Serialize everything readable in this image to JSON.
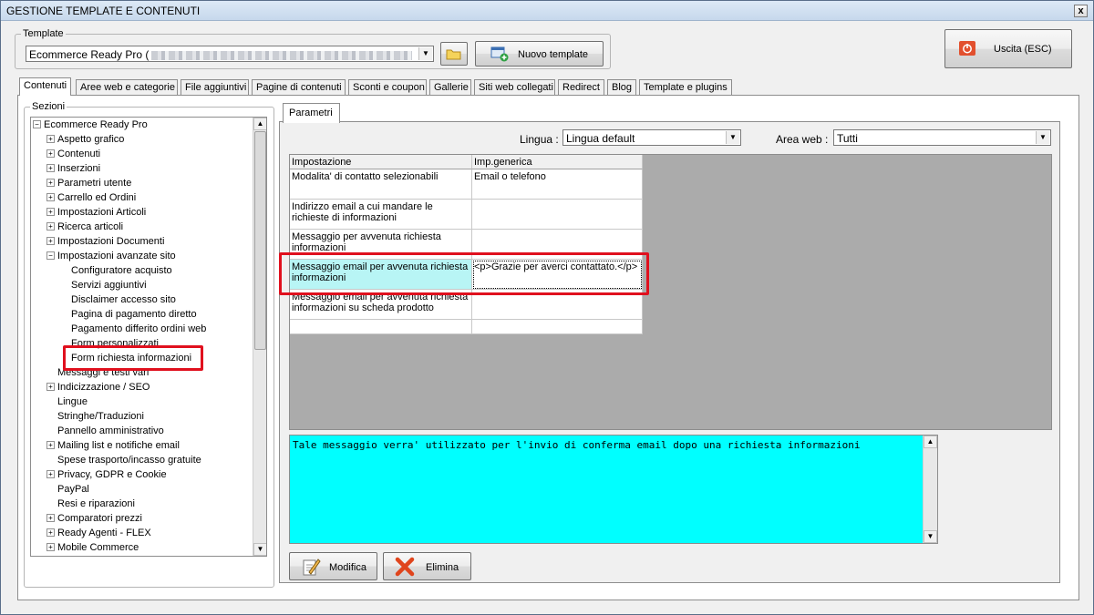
{
  "window": {
    "title": "GESTIONE TEMPLATE E CONTENUTI",
    "close_label": "x"
  },
  "template_group": {
    "legend": "Template",
    "selected": "Ecommerce Ready Pro (",
    "new_template_label": "Nuovo template"
  },
  "exit_button": {
    "label": "Uscita (ESC)"
  },
  "tabs": [
    {
      "label": "Contenuti",
      "active": true
    },
    {
      "label": "Aree web e categorie"
    },
    {
      "label": "File aggiuntivi"
    },
    {
      "label": "Pagine di contenuti"
    },
    {
      "label": "Sconti e coupon"
    },
    {
      "label": "Gallerie"
    },
    {
      "label": "Siti web collegati"
    },
    {
      "label": "Redirect"
    },
    {
      "label": "Blog"
    },
    {
      "label": "Template e plugins"
    }
  ],
  "sections": {
    "legend": "Sezioni",
    "tree": [
      {
        "label": "Ecommerce Ready Pro",
        "level": 0,
        "expander": "⊟"
      },
      {
        "label": "Aspetto grafico",
        "level": 1,
        "expander": "⊞"
      },
      {
        "label": "Contenuti",
        "level": 1,
        "expander": "⊞"
      },
      {
        "label": "Inserzioni",
        "level": 1,
        "expander": "⊞"
      },
      {
        "label": "Parametri utente",
        "level": 1,
        "expander": "⊞"
      },
      {
        "label": "Carrello ed Ordini",
        "level": 1,
        "expander": "⊞"
      },
      {
        "label": "Impostazioni Articoli",
        "level": 1,
        "expander": "⊞"
      },
      {
        "label": "Ricerca articoli",
        "level": 1,
        "expander": "⊞"
      },
      {
        "label": "Impostazioni Documenti",
        "level": 1,
        "expander": "⊞"
      },
      {
        "label": "Impostazioni avanzate sito",
        "level": 1,
        "expander": "⊟"
      },
      {
        "label": "Configuratore acquisto",
        "level": 2
      },
      {
        "label": "Servizi aggiuntivi",
        "level": 2
      },
      {
        "label": "Disclaimer accesso sito",
        "level": 2
      },
      {
        "label": "Pagina di pagamento diretto",
        "level": 2
      },
      {
        "label": "Pagamento differito ordini web",
        "level": 2
      },
      {
        "label": "Form personalizzati",
        "level": 2
      },
      {
        "label": "Form richiesta informazioni",
        "level": 2,
        "selected": true
      },
      {
        "label": "Messaggi e testi vari",
        "level": 1
      },
      {
        "label": "Indicizzazione / SEO",
        "level": 1,
        "expander": "⊞"
      },
      {
        "label": "Lingue",
        "level": 1
      },
      {
        "label": "Stringhe/Traduzioni",
        "level": 1
      },
      {
        "label": "Pannello amministrativo",
        "level": 1
      },
      {
        "label": "Mailing list e notifiche email",
        "level": 1,
        "expander": "⊞"
      },
      {
        "label": "Spese trasporto/incasso gratuite",
        "level": 1
      },
      {
        "label": "Privacy, GDPR e Cookie",
        "level": 1,
        "expander": "⊞"
      },
      {
        "label": "PayPal",
        "level": 1
      },
      {
        "label": "Resi e riparazioni",
        "level": 1
      },
      {
        "label": "Comparatori prezzi",
        "level": 1,
        "expander": "⊞"
      },
      {
        "label": "Ready Agenti - FLEX",
        "level": 1,
        "expander": "⊞"
      },
      {
        "label": "Mobile Commerce",
        "level": 1,
        "expander": "⊞"
      }
    ]
  },
  "params": {
    "tab_label": "Parametri",
    "lingua_label": "Lingua :",
    "lingua_value": "Lingua default",
    "area_label": "Area web :",
    "area_value": "Tutti",
    "headers": [
      "Impostazione",
      "Imp.generica"
    ],
    "rows": [
      {
        "setting": "Modalita' di contatto selezionabili",
        "value": "Email o telefono"
      },
      {
        "setting": "Indirizzo email a cui mandare le richieste di informazioni",
        "value": ""
      },
      {
        "setting": "Messaggio per avvenuta richiesta informazioni",
        "value": ""
      },
      {
        "setting": "Messaggio email per avvenuta richiesta informazioni",
        "value": "<p>Grazie per averci contattato.</p>",
        "selected": true
      },
      {
        "setting": "Messaggio email per avvenuta richiesta informazioni su scheda prodotto",
        "value": ""
      },
      {
        "setting": "",
        "value": ""
      }
    ],
    "description": "Tale messaggio verra' utilizzato per l'invio di conferma email dopo una richiesta informazioni",
    "edit_label": "Modifica",
    "delete_label": "Elimina"
  },
  "colors": {
    "highlight": "#e0101e",
    "description_bg": "#00ffff",
    "selected_cell": "#b8f5f5"
  }
}
